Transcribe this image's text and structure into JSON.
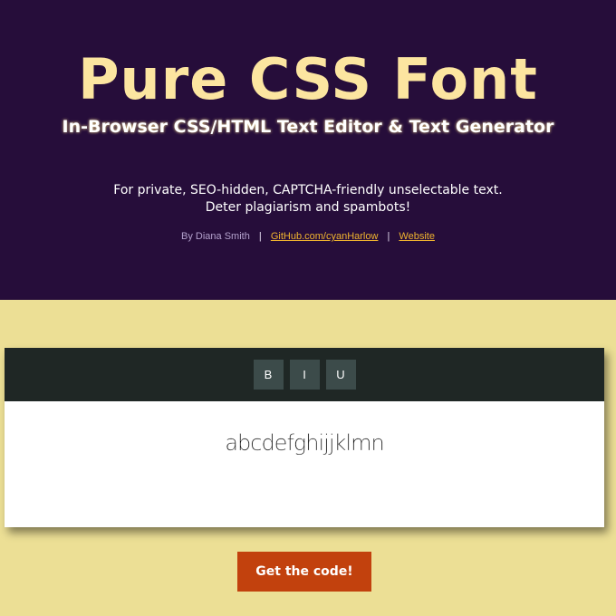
{
  "hero": {
    "title": "Pure CSS Font",
    "subtitle": "In-Browser CSS/HTML Text Editor & Text Generator",
    "description_line1": "For private, SEO-hidden, CAPTCHA-friendly unselectable text.",
    "description_line2": "Deter plagiarism and spambots!",
    "byline": {
      "author": "By Diana Smith",
      "separator": "|",
      "github_link": "GitHub.com/cyanHarlow",
      "website_link": "Website"
    }
  },
  "editor": {
    "toolbar": {
      "bold_label": "B",
      "italic_label": "I",
      "underline_label": "U"
    },
    "content_text": "abcdefghijjklmn"
  },
  "cta": {
    "label": "Get the code!"
  },
  "colors": {
    "hero_background": "#260d3a",
    "page_background": "#ecdf95",
    "title_color": "#fce5a0",
    "link_color": "#f1b42f",
    "toolbar_background": "#1f2725",
    "button_background": "#3c4b4a",
    "cta_background": "#c2410d"
  }
}
